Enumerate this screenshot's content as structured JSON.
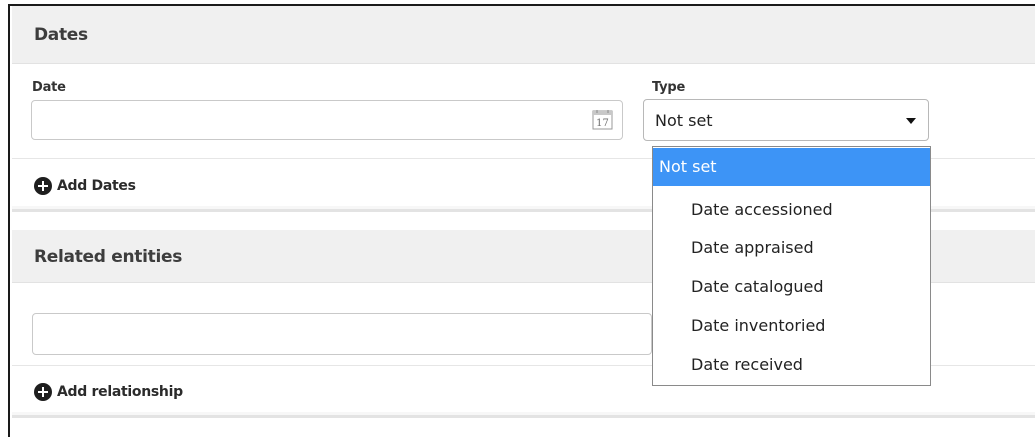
{
  "dates_section": {
    "title": "Dates",
    "date_label": "Date",
    "date_value": "",
    "calendar_icon": "calendar-icon",
    "calendar_day": "17",
    "type_label": "Type",
    "type_value": "Not set",
    "add_label": "Add Dates"
  },
  "type_dropdown": {
    "options": [
      {
        "label": "Not set",
        "selected": true
      },
      {
        "label": "Date accessioned",
        "selected": false
      },
      {
        "label": "Date appraised",
        "selected": false
      },
      {
        "label": "Date catalogued",
        "selected": false
      },
      {
        "label": "Date inventoried",
        "selected": false
      },
      {
        "label": "Date received",
        "selected": false
      }
    ],
    "highlight_color": "#3d94f6"
  },
  "related_section": {
    "title": "Related entities",
    "input_value": "",
    "add_label": "Add relationship"
  }
}
